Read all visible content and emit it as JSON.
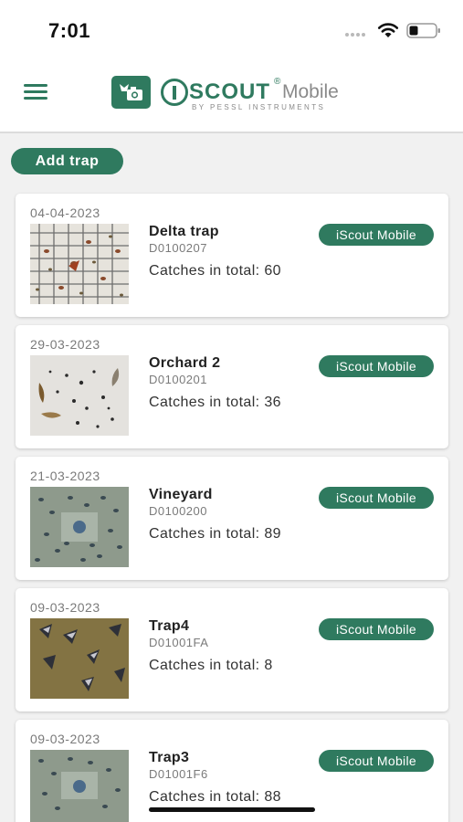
{
  "status_bar": {
    "time": "7:01"
  },
  "header": {
    "logo_letters": "SCOUT",
    "logo_registered": "®",
    "logo_mobile": "Mobile",
    "logo_tagline": "BY PESSL INSTRUMENTS"
  },
  "add_trap_label": "Add trap",
  "traps": [
    {
      "date": "04-04-2023",
      "name": "Delta trap",
      "id": "D0100207",
      "catches": "Catches in total: 60",
      "badge": "iScout Mobile",
      "thumb_icon": "delta-trap-photo"
    },
    {
      "date": "29-03-2023",
      "name": "Orchard 2",
      "id": "D0100201",
      "catches": "Catches in total: 36",
      "badge": "iScout Mobile",
      "thumb_icon": "orchard-trap-photo"
    },
    {
      "date": "21-03-2023",
      "name": "Vineyard",
      "id": "D0100200",
      "catches": "Catches in total: 89",
      "badge": "iScout Mobile",
      "thumb_icon": "vineyard-trap-photo"
    },
    {
      "date": "09-03-2023",
      "name": "Trap4",
      "id": "D01001FA",
      "catches": "Catches in total: 8",
      "badge": "iScout Mobile",
      "thumb_icon": "trap4-photo"
    },
    {
      "date": "09-03-2023",
      "name": "Trap3",
      "id": "D01001F6",
      "catches": "Catches in total: 88",
      "badge": "iScout Mobile",
      "thumb_icon": "trap3-photo"
    }
  ],
  "colors": {
    "brand_green": "#2f7a5f",
    "background": "#f1f1f1",
    "card": "#ffffff"
  }
}
